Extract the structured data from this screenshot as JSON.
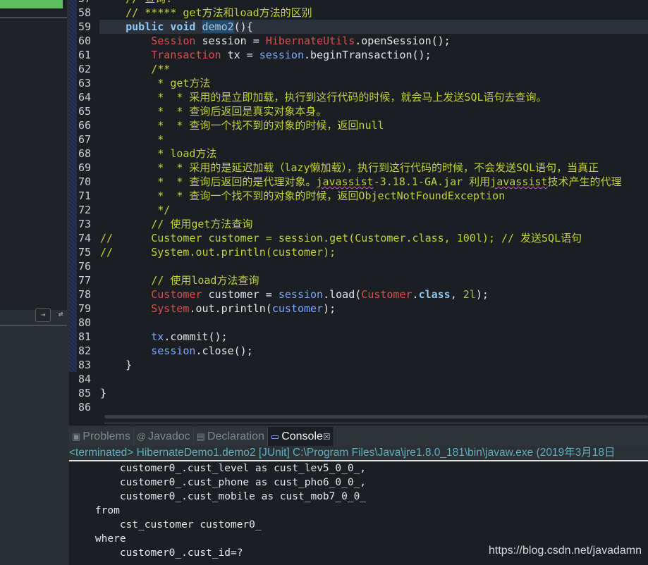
{
  "editor": {
    "current_line": 59,
    "lines": [
      {
        "n": "57",
        "tokens": [
          [
            "    ",
            "p"
          ],
          [
            "// 查询:",
            "c"
          ]
        ]
      },
      {
        "n": "58",
        "tokens": [
          [
            "    ",
            "p"
          ],
          [
            "// ***** get方法和load方法的区别",
            "c"
          ]
        ]
      },
      {
        "n": "59",
        "tokens": [
          [
            "    ",
            "p"
          ],
          [
            "public void ",
            "k"
          ],
          [
            "demo2",
            "sel"
          ],
          [
            "(){",
            "p"
          ]
        ]
      },
      {
        "n": "60",
        "tokens": [
          [
            "        ",
            "p"
          ],
          [
            "Session",
            "t"
          ],
          [
            " session = ",
            "p"
          ],
          [
            "HibernateUtils",
            "t"
          ],
          [
            ".openSession();",
            "p"
          ]
        ]
      },
      {
        "n": "61",
        "tokens": [
          [
            "        ",
            "p"
          ],
          [
            "Transaction",
            "t"
          ],
          [
            " tx = ",
            "p"
          ],
          [
            "session",
            "v"
          ],
          [
            ".beginTransaction();",
            "p"
          ]
        ]
      },
      {
        "n": "62",
        "tokens": [
          [
            "        ",
            "p"
          ],
          [
            "/**",
            "c"
          ]
        ]
      },
      {
        "n": "63",
        "tokens": [
          [
            "         * get方法",
            "c"
          ]
        ]
      },
      {
        "n": "64",
        "tokens": [
          [
            "         *  * 采用的是立即加载，执行到这行代码的时候，就会马上发送SQL语句去查询。",
            "c"
          ]
        ]
      },
      {
        "n": "65",
        "tokens": [
          [
            "         *  * 查询后返回是真实对象本身。",
            "c"
          ]
        ]
      },
      {
        "n": "66",
        "tokens": [
          [
            "         *  * 查询一个找不到的对象的时候，返回null",
            "c"
          ]
        ]
      },
      {
        "n": "67",
        "tokens": [
          [
            "         *",
            "c"
          ]
        ]
      },
      {
        "n": "68",
        "tokens": [
          [
            "         * load方法",
            "c"
          ]
        ]
      },
      {
        "n": "69",
        "tokens": [
          [
            "         *  * 采用的是延迟加载（lazy懒加载），执行到这行代码的时候，不会发送SQL语句，当真正",
            "c"
          ]
        ]
      },
      {
        "n": "70",
        "tokens": [
          [
            "         *  * 查询后返回的是代理对象。",
            "c"
          ],
          [
            "javassist",
            "c sq"
          ],
          [
            "-3.18.1-GA.jar 利用",
            "c"
          ],
          [
            "javassist",
            "c sq"
          ],
          [
            "技术产生的代理",
            "c"
          ]
        ]
      },
      {
        "n": "71",
        "tokens": [
          [
            "         *  * 查询一个找不到的对象的时候，返回ObjectNotFoundException",
            "c"
          ]
        ]
      },
      {
        "n": "72",
        "tokens": [
          [
            "         */",
            "c"
          ]
        ]
      },
      {
        "n": "73",
        "tokens": [
          [
            "        ",
            "p"
          ],
          [
            "// 使用get方法查询",
            "c"
          ]
        ]
      },
      {
        "n": "74",
        "tokens": [
          [
            "//      Customer customer = session.get(Customer.class, 100l); // 发送SQL语句",
            "c"
          ]
        ]
      },
      {
        "n": "75",
        "tokens": [
          [
            "//      System.out.println(customer);",
            "c"
          ]
        ]
      },
      {
        "n": "76",
        "tokens": []
      },
      {
        "n": "77",
        "tokens": [
          [
            "        ",
            "p"
          ],
          [
            "// 使用load方法查询",
            "c"
          ]
        ]
      },
      {
        "n": "78",
        "tokens": [
          [
            "        ",
            "p"
          ],
          [
            "Customer",
            "t"
          ],
          [
            " customer = ",
            "p"
          ],
          [
            "session",
            "v"
          ],
          [
            ".load(",
            "p"
          ],
          [
            "Customer",
            "t"
          ],
          [
            ".",
            "p"
          ],
          [
            "class",
            "k"
          ],
          [
            ", ",
            "p"
          ],
          [
            "2l",
            "n"
          ],
          [
            ");",
            "p"
          ]
        ]
      },
      {
        "n": "79",
        "tokens": [
          [
            "        ",
            "p"
          ],
          [
            "System",
            "t"
          ],
          [
            ".out.println(",
            "p"
          ],
          [
            "customer",
            "v"
          ],
          [
            ");",
            "p"
          ]
        ]
      },
      {
        "n": "80",
        "tokens": []
      },
      {
        "n": "81",
        "tokens": [
          [
            "        ",
            "p"
          ],
          [
            "tx",
            "v"
          ],
          [
            ".commit();",
            "p"
          ]
        ]
      },
      {
        "n": "82",
        "tokens": [
          [
            "        ",
            "p"
          ],
          [
            "session",
            "v"
          ],
          [
            ".close();",
            "p"
          ]
        ]
      },
      {
        "n": "83",
        "tokens": [
          [
            "    }",
            "p"
          ]
        ]
      },
      {
        "n": "84",
        "tokens": []
      },
      {
        "n": "85",
        "tokens": [
          [
            "}",
            "p"
          ]
        ]
      },
      {
        "n": "86",
        "tokens": []
      }
    ]
  },
  "panel": {
    "tabs": [
      {
        "label": "Problems",
        "icon": "problems-icon",
        "glyph": "▣",
        "active": false
      },
      {
        "label": "Javadoc",
        "icon": "at-icon",
        "glyph": "@",
        "active": false
      },
      {
        "label": "Declaration",
        "icon": "declaration-icon",
        "glyph": "▤",
        "active": false
      },
      {
        "label": "Console",
        "icon": "console-icon",
        "glyph": "▭",
        "active": true
      }
    ],
    "close_glyph": "☒",
    "terminated_line": "<terminated> HibernateDemo1.demo2 [JUnit] C:\\Program Files\\Java\\jre1.8.0_181\\bin\\javaw.exe (2019年3月18日 ",
    "output": [
      "        customer0_.cust_level as cust_lev5_0_0_,",
      "        customer0_.cust_phone as cust_pho6_0_0_,",
      "        customer0_.cust_mobile as cust_mob7_0_0_",
      "    from",
      "        cst_customer customer0_",
      "    where",
      "        customer0_.cust_id=?"
    ]
  },
  "watermark": "https://blog.csdn.net/javadamn",
  "colors": {
    "comment": "#c2d135",
    "keyword": "#8ec8f0",
    "type": "#d6504f",
    "variable": "#79abff",
    "number": "#a4c25f",
    "background": "#1b1e23"
  }
}
